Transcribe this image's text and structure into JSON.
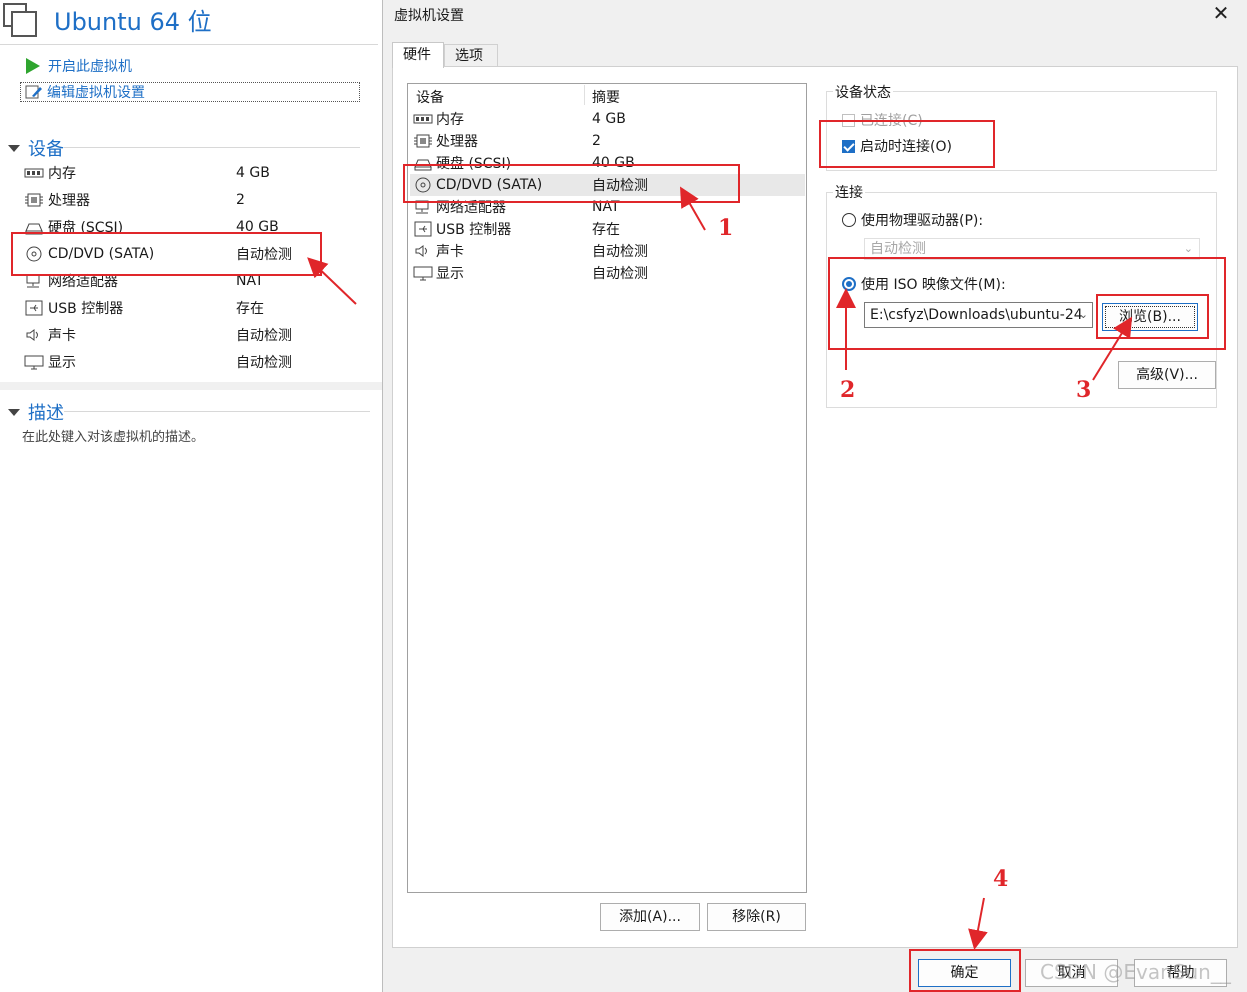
{
  "left": {
    "vm_title": "Ubuntu 64 位",
    "actions": {
      "power_on": "开启此虚拟机",
      "edit_settings": "编辑虚拟机设置"
    },
    "devices_heading": "设备",
    "devices": [
      {
        "name": "内存",
        "value": "4 GB",
        "icon": "memory-icon"
      },
      {
        "name": "处理器",
        "value": "2",
        "icon": "processor-icon"
      },
      {
        "name": "硬盘 (SCSI)",
        "value": "40 GB",
        "icon": "harddisk-icon"
      },
      {
        "name": "CD/DVD (SATA)",
        "value": "自动检测",
        "icon": "cd-dvd-icon"
      },
      {
        "name": "网络适配器",
        "value": "NAT",
        "icon": "network-icon"
      },
      {
        "name": "USB 控制器",
        "value": "存在",
        "icon": "usb-icon"
      },
      {
        "name": "声卡",
        "value": "自动检测",
        "icon": "speaker-icon"
      },
      {
        "name": "显示",
        "value": "自动检测",
        "icon": "display-icon"
      }
    ],
    "description_heading": "描述",
    "description_placeholder": "在此处键入对该虚拟机的描述。"
  },
  "dialog": {
    "title": "虚拟机设置",
    "tabs": [
      "硬件",
      "选项"
    ],
    "hardware_columns": [
      "设备",
      "摘要"
    ],
    "hardware": [
      {
        "name": "内存",
        "value": "4 GB",
        "icon": "memory-icon"
      },
      {
        "name": "处理器",
        "value": "2",
        "icon": "processor-icon"
      },
      {
        "name": "硬盘 (SCSI)",
        "value": "40 GB",
        "icon": "harddisk-icon"
      },
      {
        "name": "CD/DVD (SATA)",
        "value": "自动检测",
        "icon": "cd-dvd-icon",
        "selected": true
      },
      {
        "name": "网络适配器",
        "value": "NAT",
        "icon": "network-icon"
      },
      {
        "name": "USB 控制器",
        "value": "存在",
        "icon": "usb-icon"
      },
      {
        "name": "声卡",
        "value": "自动检测",
        "icon": "speaker-icon"
      },
      {
        "name": "显示",
        "value": "自动检测",
        "icon": "display-icon"
      }
    ],
    "add_button": "添加(A)...",
    "remove_button": "移除(R)",
    "device_status": {
      "label": "设备状态",
      "connected": "已连接(C)",
      "connect_on_power": "启动时连接(O)",
      "connected_checked": false,
      "connect_on_power_checked": true
    },
    "connection": {
      "label": "连接",
      "physical": "使用物理驱动器(P):",
      "physical_value": "自动检测",
      "iso": "使用 ISO 映像文件(M):",
      "iso_value": "E:\\csfyz\\Downloads\\ubuntu-24",
      "browse": "浏览(B)...",
      "advanced": "高级(V)..."
    },
    "ok": "确定",
    "cancel": "取消",
    "help": "帮助"
  },
  "annotations": [
    "1",
    "2",
    "3",
    "4"
  ],
  "watermark": "CSDN @EvanSun__",
  "colors": {
    "accent": "#1e6fc6",
    "annotation": "#e0262a",
    "play": "#2fa52f"
  }
}
